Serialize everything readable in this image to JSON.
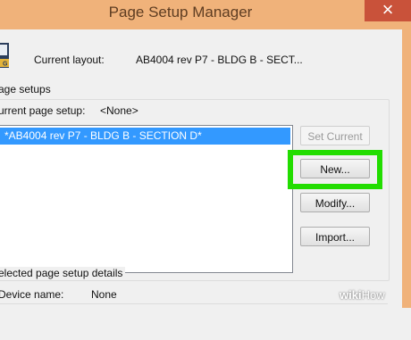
{
  "window": {
    "title": "Page Setup Manager",
    "close_glyph": "×"
  },
  "layout": {
    "label": "Current layout:",
    "value": "AB4004 rev P7 - BLDG B - SECT..."
  },
  "page_setups": {
    "group_label": "age setups",
    "current_label": "urrent page setup:",
    "current_value": "<None>",
    "items": [
      "*AB4004 rev P7 - BLDG B - SECTION D*"
    ]
  },
  "buttons": {
    "set_current": "Set Current",
    "new": "New...",
    "modify": "Modify...",
    "import": "Import..."
  },
  "details": {
    "group_label": "elected page setup details",
    "device_label": "Device name:",
    "device_value": "None"
  },
  "watermark": {
    "part1": "wiki",
    "part2": "How"
  },
  "colors": {
    "titlebar": "#f0b27a",
    "close": "#c9523a",
    "selection": "#3399ff",
    "highlight": "#22dd00"
  }
}
